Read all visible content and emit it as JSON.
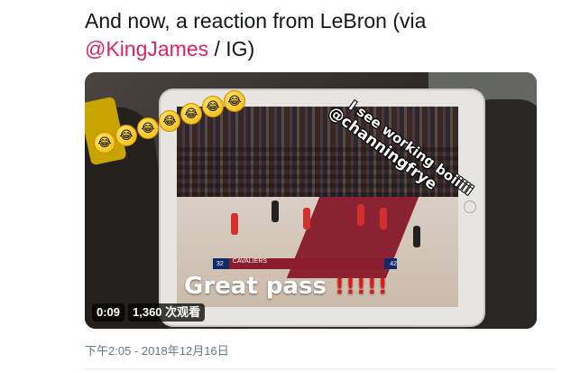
{
  "tweet": {
    "text_main": "And now, a reaction from LeBron (via ",
    "mention": "@KingJames",
    "text_tail": " / IG)"
  },
  "video": {
    "overlay_caption": "Great pass",
    "overlay_bangs": "!!!!!",
    "story_line1": "I see working boiiiii",
    "story_line2": "@channingfrye",
    "duration": "0:09",
    "views": "1,360 次观看",
    "scoreboard": {
      "home_team": "CAVALIERS",
      "home_score": "42",
      "away_score": "32"
    }
  },
  "meta": {
    "timestamp": "下午2:05 - 2018年12月16日"
  }
}
